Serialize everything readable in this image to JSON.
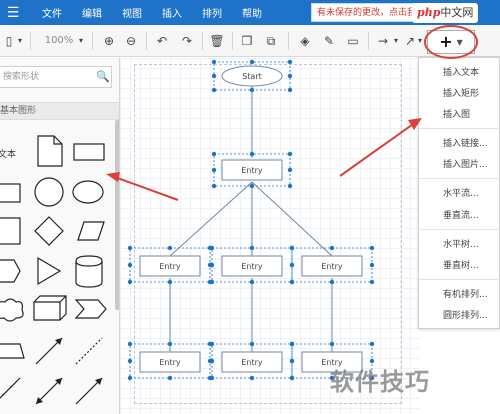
{
  "menubar": {
    "items": [
      "文件",
      "编辑",
      "视图",
      "插入",
      "排列",
      "帮助"
    ],
    "unsaved_notice": "有未保存的更改，点击我保存",
    "colors": {
      "bar": "#1e73c8",
      "notice": "#d23b2f"
    }
  },
  "watermark_top": {
    "php": "php",
    "cn": "中文网"
  },
  "toolbar": {
    "zoom": "100%",
    "icons": [
      "format-panel-icon",
      "zoom-in-icon",
      "zoom-out-icon",
      "undo-icon",
      "redo-icon",
      "delete-icon",
      "to-front-icon",
      "to-back-icon",
      "fill-color-icon",
      "line-color-icon",
      "shadow-icon",
      "connection-icon",
      "waypoints-icon",
      "insert-plus-icon"
    ]
  },
  "left_panel": {
    "search_placeholder": "搜索形状",
    "category": "基本图形",
    "text_shape_label": "文本"
  },
  "diagram": {
    "start_label": "Start",
    "entry_label": "Entry",
    "selection_color": "#1e73c8"
  },
  "insert_menu": {
    "groups": [
      [
        "插入文本",
        "插入矩形",
        "插入图"
      ],
      [
        "插入链接...",
        "插入图片..."
      ],
      [
        "水平流...",
        "垂直流..."
      ],
      [
        "水平树...",
        "垂直树..."
      ],
      [
        "有机排列...",
        "圆形排列..."
      ]
    ]
  },
  "annotations": {
    "arrow_color": "#d9413a"
  },
  "watermark_bottom": "软件技巧"
}
